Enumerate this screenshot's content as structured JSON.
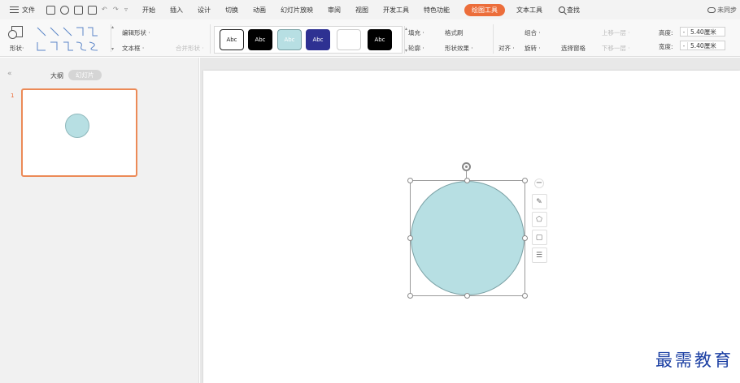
{
  "menubar": {
    "file_label": "文件",
    "tabs": [
      {
        "label": "开始",
        "active": false
      },
      {
        "label": "插入",
        "active": false
      },
      {
        "label": "设计",
        "active": false
      },
      {
        "label": "切换",
        "active": false
      },
      {
        "label": "动画",
        "active": false
      },
      {
        "label": "幻灯片放映",
        "active": false
      },
      {
        "label": "审阅",
        "active": false
      },
      {
        "label": "视图",
        "active": false
      },
      {
        "label": "开发工具",
        "active": false
      },
      {
        "label": "特色功能",
        "active": false
      },
      {
        "label": "绘图工具",
        "active": true
      },
      {
        "label": "文本工具",
        "active": false
      }
    ],
    "search_label": "查找",
    "sync_label": "未同步"
  },
  "ribbon": {
    "shape_label": "形状·",
    "edit_shape": "编辑形状 ·",
    "text_box": "文本框 ·",
    "merge_shape": "合并形状 ·",
    "style_swatches": [
      {
        "label": "Abc",
        "bg": "#ffffff",
        "fg": "#222222",
        "border": "#222222"
      },
      {
        "label": "Abc",
        "bg": "#000000",
        "fg": "#ffffff",
        "border": "#000000"
      },
      {
        "label": "Abc",
        "bg": "#b7dfe3",
        "fg": "#ffffff",
        "border": "#7aa0a4"
      },
      {
        "label": "Abc",
        "bg": "#2e3192",
        "fg": "#ffffff",
        "border": "#2e3192"
      },
      {
        "label": "",
        "bg": "#ffffff",
        "fg": "#222222",
        "border": "#cccccc"
      },
      {
        "label": "Abc",
        "bg": "#000000",
        "fg": "#ffffff",
        "border": "#000000"
      }
    ],
    "fill": "填充 ·",
    "format_painter": "格式刷",
    "outline": "轮廓 ·",
    "shape_effect": "形状效果 ·",
    "align": "对齐 ·",
    "group": "组合 ·",
    "rotate": "旋转 ·",
    "selection_pane": "选择窗格",
    "bring_forward": "上移一层 ·",
    "send_backward": "下移一层 ·",
    "height_label": "高度:",
    "height_value": "5.40厘米",
    "width_label": "宽度:",
    "width_value": "5.40厘米"
  },
  "left_panel": {
    "outline_tab": "大纲",
    "slides_tab": "幻灯片",
    "slide_number": "1"
  },
  "colors": {
    "accent": "#ec6d3a",
    "shape_fill": "#b7dfe3",
    "watermark": "#1b3fa3"
  },
  "watermark": "最需教育"
}
